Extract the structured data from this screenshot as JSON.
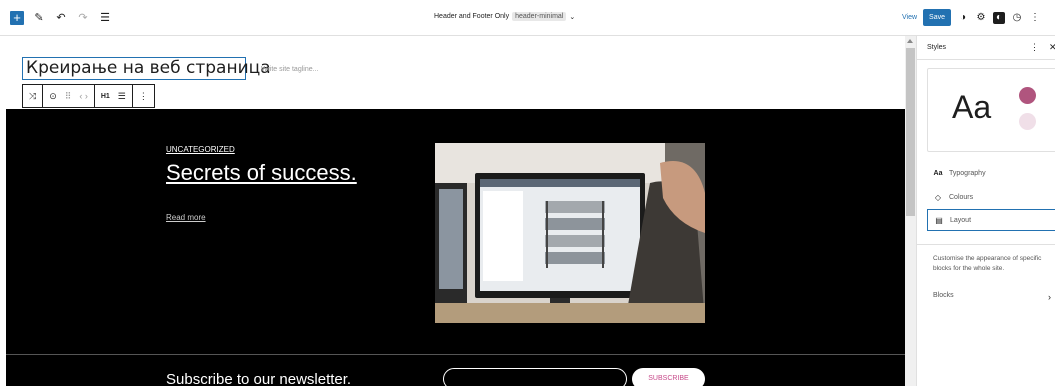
{
  "topbar": {
    "add_label": "+",
    "template_name": "Header and Footer Only",
    "template_slug": "header-minimal",
    "dropdown_glyph": "⌄",
    "view_label": "View",
    "save_label": "Save",
    "icons": {
      "edit": "✎",
      "undo": "↶",
      "redo": "↷",
      "outline": "☰",
      "styles": "◑",
      "settings": "⚙",
      "contrast": "◐",
      "clock": "◷",
      "more": "⋮"
    }
  },
  "canvas": {
    "site_title": "Креирање на веб страница",
    "tagline_placeholder": "Write site tagline...",
    "block_toolbar": {
      "transform": "⤨",
      "location": "⊙",
      "drag": "⠿",
      "move": "‹ ›",
      "heading_level": "H1",
      "align": "☰",
      "more": "⋮"
    },
    "post": {
      "category": "UNCATEGORIZED",
      "title": "Secrets of success.",
      "read_more": "Read more"
    },
    "newsletter": {
      "heading": "Subscribe to our newsletter.",
      "button_label": "SUBSCRIBE"
    }
  },
  "sidebar": {
    "title": "Styles",
    "more_glyph": "⋮",
    "close_glyph": "✕",
    "preview_text": "Aa",
    "colors": {
      "primary": "#b0557e",
      "secondary": "#f0dfe8",
      "accent": "#2271b1"
    },
    "items": [
      {
        "icon": "Aa",
        "label": "Typography"
      },
      {
        "icon": "◇",
        "label": "Colours"
      },
      {
        "icon": "▤",
        "label": "Layout"
      }
    ],
    "description": "Customise the appearance of specific blocks for the whole site.",
    "blocks_label": "Blocks",
    "blocks_chevron": "›"
  }
}
